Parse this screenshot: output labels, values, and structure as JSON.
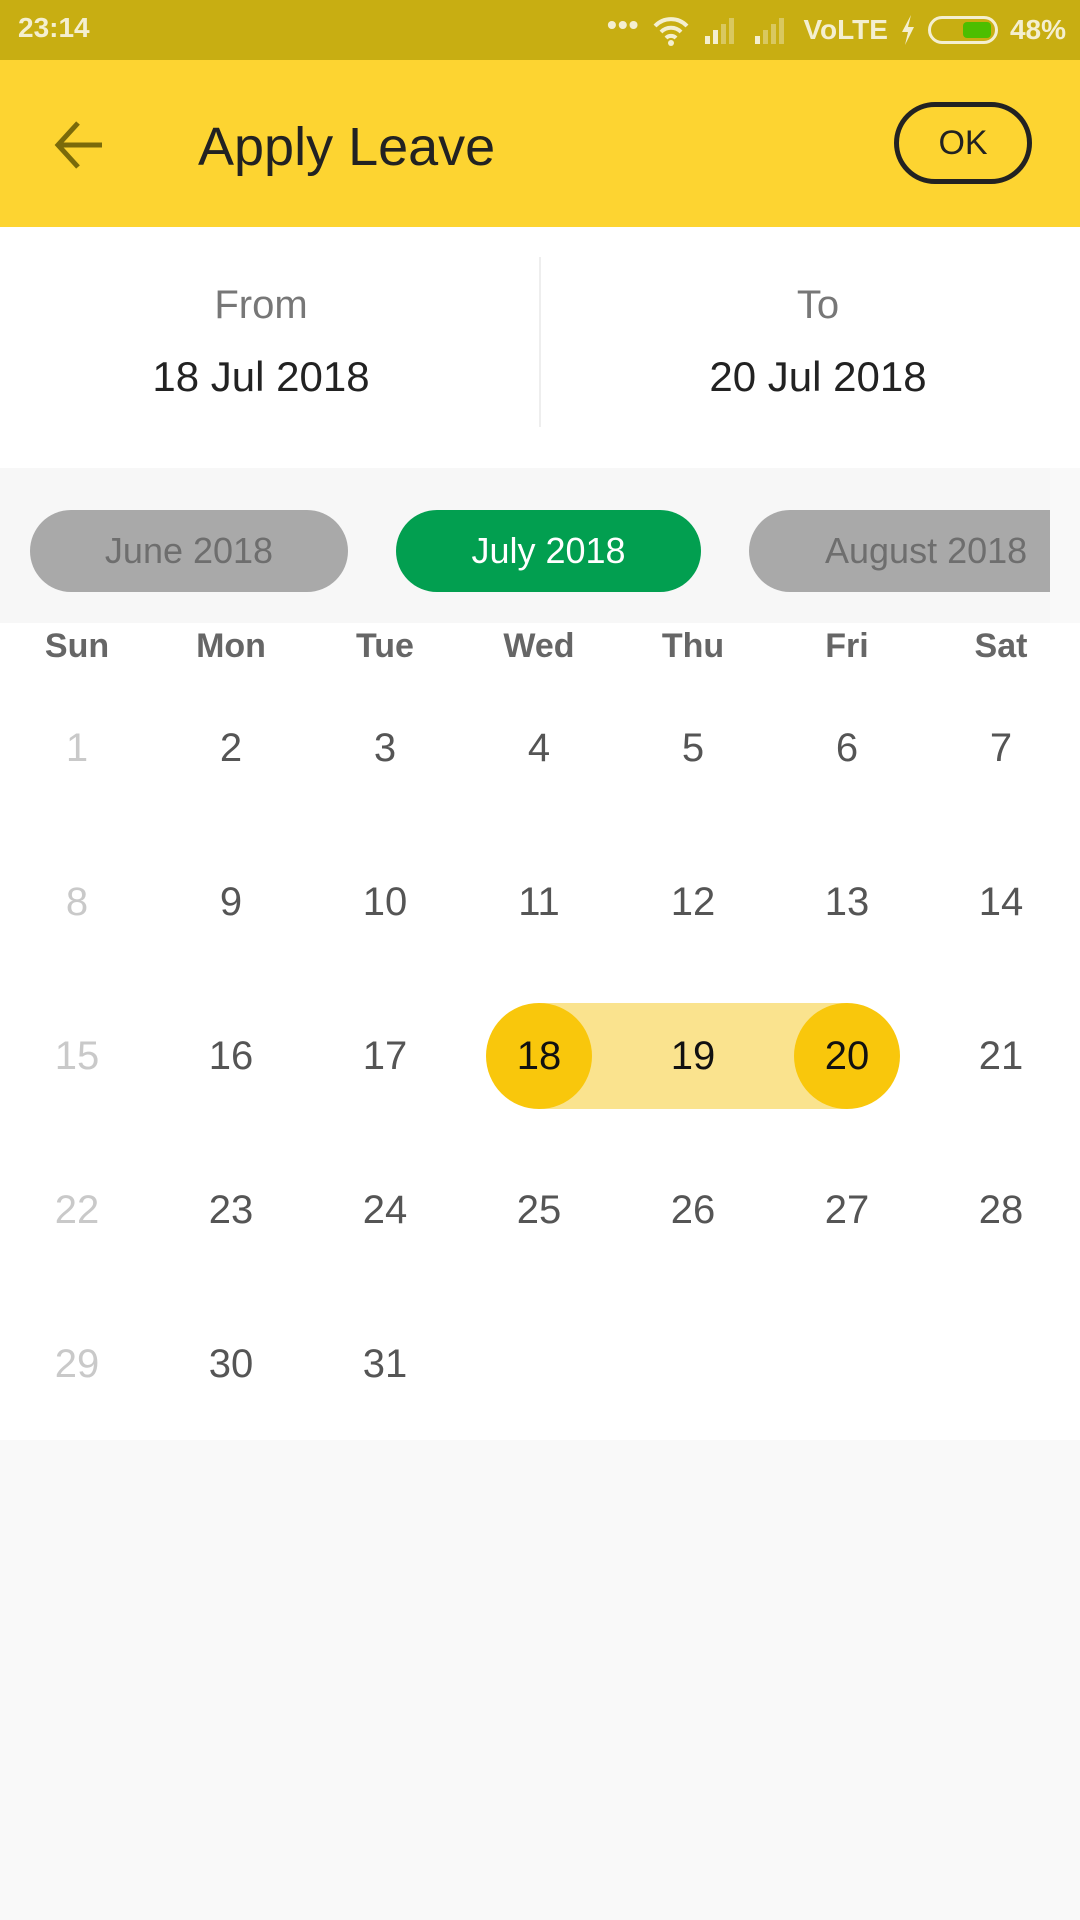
{
  "status_bar": {
    "time": "23:14",
    "more_icon": "more-dots-icon",
    "wifi_icon": "wifi-icon",
    "signal_icons": [
      "signal-icon",
      "signal-icon"
    ],
    "network": "VoLTE",
    "charging_icon": "charging-bolt-icon",
    "battery_icon": "battery-icon",
    "battery_percent": "48%",
    "battery_level": 0.48,
    "battery_color": "#4cbe00"
  },
  "app_bar": {
    "back_icon": "arrow-back-icon",
    "title": "Apply Leave",
    "ok_label": "OK",
    "color": "#fdd431"
  },
  "range": {
    "from_label": "From",
    "from_value": "18 Jul 2018",
    "to_label": "To",
    "to_value": "20 Jul 2018"
  },
  "months": {
    "prev": "June 2018",
    "current": "July 2018",
    "next": "August 2018",
    "current_color": "#029f50"
  },
  "calendar": {
    "weekdays": [
      "Sun",
      "Mon",
      "Tue",
      "Wed",
      "Thu",
      "Fri",
      "Sat"
    ],
    "first_weekday_index": 0,
    "days_in_month": 31,
    "selected_start": 18,
    "selected_end": 20,
    "selected_color": "#f9c70c",
    "range_color": "#fae38e",
    "days": [
      "1",
      "2",
      "3",
      "4",
      "5",
      "6",
      "7",
      "8",
      "9",
      "10",
      "11",
      "12",
      "13",
      "14",
      "15",
      "16",
      "17",
      "18",
      "19",
      "20",
      "21",
      "22",
      "23",
      "24",
      "25",
      "26",
      "27",
      "28",
      "29",
      "30",
      "31"
    ]
  }
}
